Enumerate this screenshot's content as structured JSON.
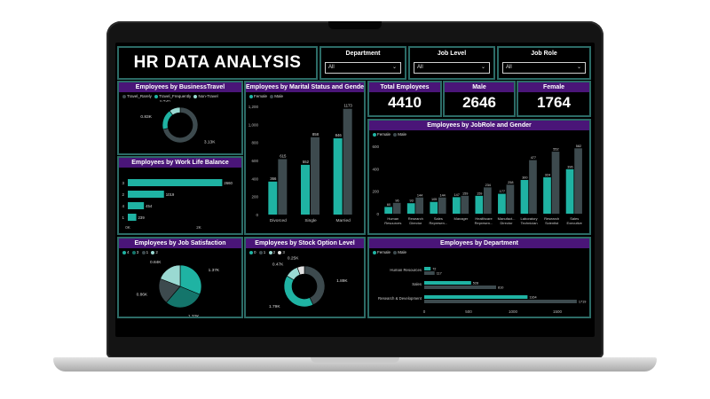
{
  "dashboard": {
    "title": "HR DATA ANALYSIS"
  },
  "filters": [
    {
      "label": "Department",
      "value": "All"
    },
    {
      "label": "Job Level",
      "value": "All"
    },
    {
      "label": "Job Role",
      "value": "All"
    }
  ],
  "kpis": [
    {
      "label": "Total Employees",
      "value": "4410"
    },
    {
      "label": "Male",
      "value": "2646"
    },
    {
      "label": "Female",
      "value": "1764"
    }
  ],
  "colors": {
    "teal": "#1fb3a3",
    "gray": "#3d4a4e",
    "purple": "#4a1578",
    "border": "#2c6b66"
  },
  "chart_data": [
    {
      "id": "business_travel",
      "type": "pie",
      "title": "Employees by BusinessTravel",
      "legend": [
        "Travel_Rarely",
        "Travel_Frequently",
        "Non-Travel"
      ],
      "slices": [
        {
          "name": "Travel_Rarely",
          "value": 3.13,
          "label": "3.13K",
          "color": "#3d4a4e"
        },
        {
          "name": "Travel_Frequently",
          "value": 0.83,
          "label": "0.83K",
          "color": "#1fb3a3"
        },
        {
          "name": "Non-Travel",
          "value": 0.45,
          "label": "0.45K",
          "color": "#9ad9d2"
        }
      ]
    },
    {
      "id": "marital",
      "type": "bar",
      "title": "Employees by Marital Status and Gender",
      "legend": [
        "Female",
        "Male"
      ],
      "categories": [
        "Divorced",
        "Single",
        "Married"
      ],
      "series": [
        {
          "name": "Female",
          "values": [
            366,
            552,
            846
          ],
          "color": "#1fb3a3"
        },
        {
          "name": "Male",
          "values": [
            615,
            858,
            1173
          ],
          "color": "#3d4a4e"
        }
      ],
      "ylim": [
        0,
        1200
      ],
      "yticks": [
        0,
        200,
        400,
        600,
        800,
        "1,000",
        "1,200"
      ]
    },
    {
      "id": "jobrole",
      "type": "bar",
      "title": "Employees by JobRole and Gender",
      "legend": [
        "Female",
        "Male"
      ],
      "categories": [
        "Human Resources",
        "Research Director",
        "Sales Represen...",
        "Manager",
        "Healthcare Represen...",
        "Manufact... Director",
        "Laboratory Technician",
        "Research Scientist",
        "Sales Executive"
      ],
      "series": [
        {
          "name": "Female",
          "values": [
            60,
            93,
            105,
            147,
            159,
            177,
            300,
            324,
            396
          ],
          "color": "#1fb3a3"
        },
        {
          "name": "Male",
          "values": [
            96,
            144,
            144,
            159,
            234,
            258,
            477,
            552,
            582
          ],
          "color": "#3d4a4e"
        }
      ],
      "ylim": [
        0,
        600
      ],
      "yticks": [
        0,
        200,
        400,
        600
      ]
    },
    {
      "id": "worklife",
      "type": "bar",
      "title": "Employees by Work Life Balance",
      "categories": [
        "3",
        "2",
        "4",
        "1"
      ],
      "values": [
        2660,
        1019,
        454,
        239
      ],
      "xlim": [
        0,
        2800
      ],
      "xticks": [
        "0K",
        "2K"
      ],
      "color": "#1fb3a3"
    },
    {
      "id": "job_satisfaction",
      "type": "pie",
      "title": "Employees by Job Satisfaction",
      "legend": [
        "4",
        "3",
        "1",
        "2"
      ],
      "slices": [
        {
          "name": "4",
          "value": 1.37,
          "label": "1.37K",
          "color": "#1fb3a3"
        },
        {
          "name": "3",
          "value": 1.32,
          "label": "1.32K",
          "color": "#14756b"
        },
        {
          "name": "1",
          "value": 0.86,
          "label": "0.86K",
          "color": "#3d4a4e"
        },
        {
          "name": "2",
          "value": 0.84,
          "label": "0.84K",
          "color": "#9ad9d2"
        }
      ]
    },
    {
      "id": "stock_option",
      "type": "pie",
      "title": "Employees by Stock Option Level",
      "legend": [
        "0",
        "1",
        "2",
        "3"
      ],
      "slices": [
        {
          "name": "1",
          "value": 1.89,
          "label": "1.89K",
          "color": "#3d4a4e"
        },
        {
          "name": "0",
          "value": 1.79,
          "label": "1.79K",
          "color": "#1fb3a3"
        },
        {
          "name": "2",
          "value": 0.47,
          "label": "0.47K",
          "color": "#9ad9d2"
        },
        {
          "name": "3",
          "value": 0.25,
          "label": "0.25K",
          "color": "#e3e3e3"
        }
      ]
    },
    {
      "id": "department",
      "type": "bar",
      "title": "Employees by Department",
      "legend": [
        "Female",
        "Male"
      ],
      "categories": [
        "Human Resources",
        "Sales",
        "Research & Development"
      ],
      "series": [
        {
          "name": "Female",
          "values": [
            72,
            528,
            1164
          ],
          "color": "#1fb3a3"
        },
        {
          "name": "Male",
          "values": [
            117,
            810,
            1719
          ],
          "color": "#3d4a4e"
        }
      ],
      "xlim": [
        0,
        1800
      ],
      "xticks": [
        0,
        500,
        1000,
        1500
      ]
    }
  ]
}
